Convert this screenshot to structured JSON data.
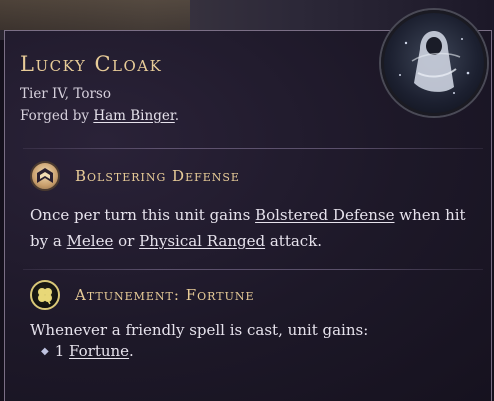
{
  "item": {
    "name": "Lucky Cloak",
    "subtitle": "Tier IV, Torso",
    "forged_prefix": "Forged by ",
    "forged_by": "Ham Binger",
    "forged_suffix": "."
  },
  "sections": [
    {
      "icon": "shield-chevron-icon",
      "title": "Bolstering Defense",
      "text_a": "Once per turn this unit gains ",
      "link_a": "Bolstered Defense",
      "text_b": " when hit by a ",
      "link_b": "Melee",
      "text_c": " or ",
      "link_c": "Physical Ranged",
      "text_d": " attack."
    },
    {
      "icon": "clover-icon",
      "title": "Attunement: Fortune",
      "text": "Whenever a friendly spell is cast, unit gains:",
      "bullet_number": "1",
      "bullet_link": "Fortune",
      "bullet_suffix": "."
    }
  ],
  "colors": {
    "title": "#e8cc98",
    "text": "#e6e2ec",
    "border": "#7b6f86"
  }
}
